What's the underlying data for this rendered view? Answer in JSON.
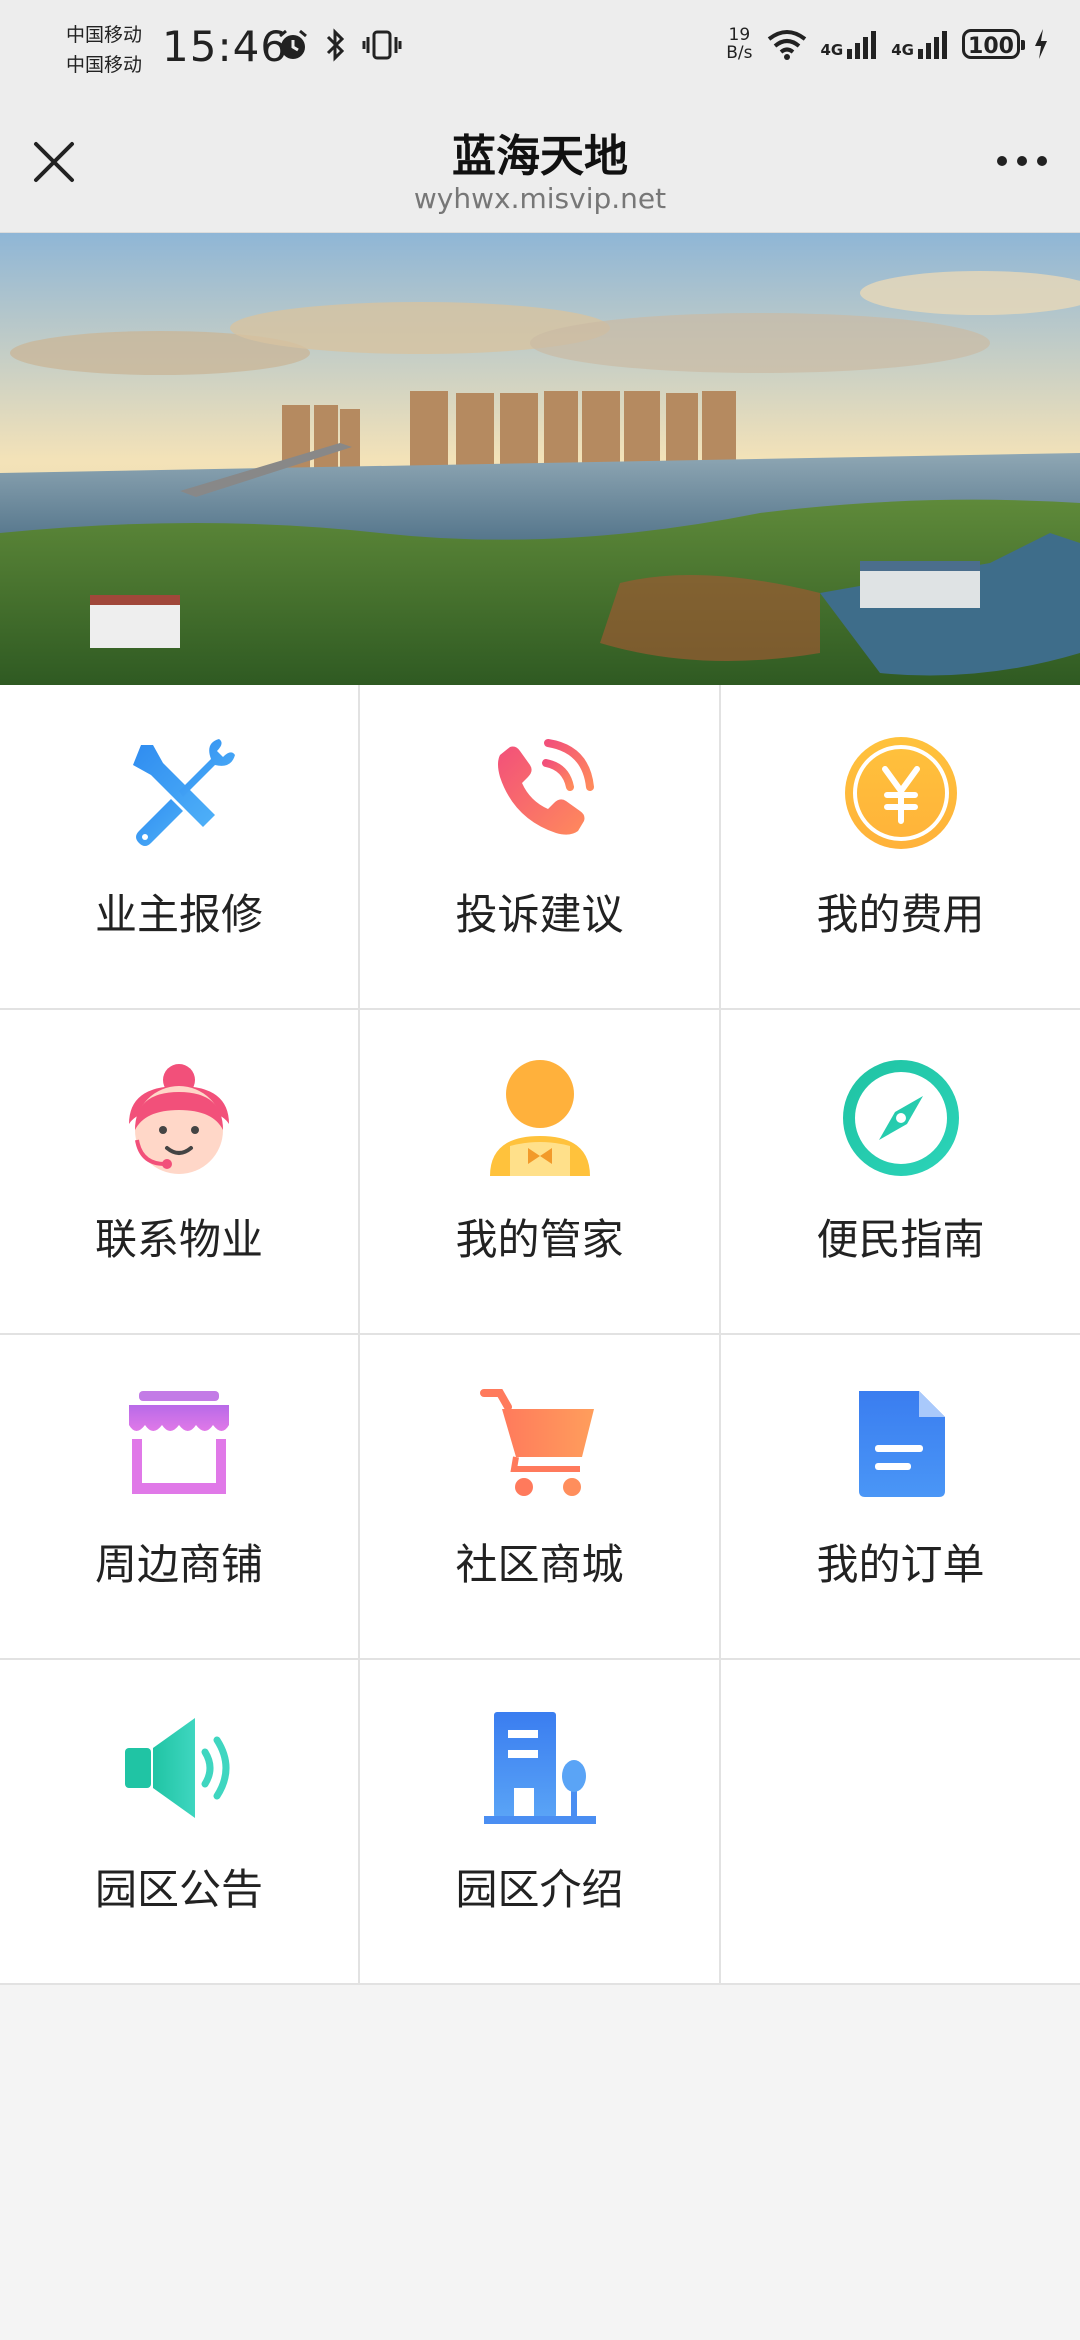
{
  "status_bar": {
    "carrier_1": "中国移动",
    "carrier_2": "中国移动",
    "time": "15:46",
    "net_speed_value": "19",
    "net_speed_unit": "B/s",
    "signal_1": "4G",
    "signal_2": "4G",
    "battery": "100"
  },
  "nav": {
    "title": "蓝海天地",
    "subtitle": "wyhwx.misvip.net"
  },
  "grid": [
    {
      "label": "业主报修",
      "icon": "wrench-screwdriver-icon"
    },
    {
      "label": "投诉建议",
      "icon": "phone-call-icon"
    },
    {
      "label": "我的费用",
      "icon": "yen-coin-icon"
    },
    {
      "label": "联系物业",
      "icon": "customer-service-icon"
    },
    {
      "label": "我的管家",
      "icon": "butler-icon"
    },
    {
      "label": "便民指南",
      "icon": "compass-icon"
    },
    {
      "label": "周边商铺",
      "icon": "storefront-icon"
    },
    {
      "label": "社区商城",
      "icon": "shopping-cart-icon"
    },
    {
      "label": "我的订单",
      "icon": "document-icon"
    },
    {
      "label": "园区公告",
      "icon": "speaker-icon"
    },
    {
      "label": "园区介绍",
      "icon": "building-icon"
    }
  ]
}
